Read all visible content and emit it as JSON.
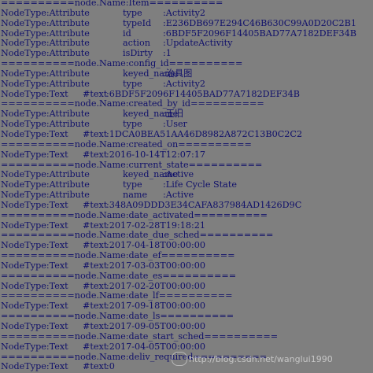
{
  "lines": [
    {
      "kind": "sep",
      "text": "==========node.Name:Item=========="
    },
    {
      "kind": "attr",
      "node": "NodeType:Attribute",
      "key": "type",
      "val": ":Activity2"
    },
    {
      "kind": "attr",
      "node": "NodeType:Attribute",
      "key": "typeId",
      "val": ":E236DB697E294C46B630C99A0D20C2B1"
    },
    {
      "kind": "attr",
      "node": "NodeType:Attribute",
      "key": "id",
      "val": ":6BDF5F2096F14405BAD77A7182DEF34B"
    },
    {
      "kind": "attr",
      "node": "NodeType:Attribute",
      "key": "action",
      "val": ":UpdateActivity"
    },
    {
      "kind": "attr",
      "node": "NodeType:Attribute",
      "key": "isDirty",
      "val": ":1"
    },
    {
      "kind": "sep",
      "text": "==========node.Name:config_id=========="
    },
    {
      "kind": "attr",
      "node": "NodeType:Attribute",
      "key": "keyed_name",
      "val": ":治具图"
    },
    {
      "kind": "attr",
      "node": "NodeType:Attribute",
      "key": "type",
      "val": ":Activity2"
    },
    {
      "kind": "text",
      "node": "NodeType:Text",
      "key": "#text",
      "val": ":6BDF5F2096F14405BAD77A7182DEF34B"
    },
    {
      "kind": "sep",
      "text": "==========node.Name:created_by_id=========="
    },
    {
      "kind": "attr",
      "node": "NodeType:Attribute",
      "key": "keyed_name",
      "val": ":王旧"
    },
    {
      "kind": "attr",
      "node": "NodeType:Attribute",
      "key": "type",
      "val": ":User"
    },
    {
      "kind": "text",
      "node": "NodeType:Text",
      "key": "#text",
      "val": ":1DCA0BEA51AA46D8982A872C13B0C2C2"
    },
    {
      "kind": "sep",
      "text": "==========node.Name:created_on=========="
    },
    {
      "kind": "text",
      "node": "NodeType:Text",
      "key": "#text",
      "val": ":2016-10-14T12:07:17"
    },
    {
      "kind": "sep",
      "text": "==========node.Name:current_state=========="
    },
    {
      "kind": "attr",
      "node": "NodeType:Attribute",
      "key": "keyed_name",
      "val": ":Active"
    },
    {
      "kind": "attr",
      "node": "NodeType:Attribute",
      "key": "type",
      "val": ":Life Cycle State"
    },
    {
      "kind": "attr",
      "node": "NodeType:Attribute",
      "key": "name",
      "val": ":Active"
    },
    {
      "kind": "text",
      "node": "NodeType:Text",
      "key": "#text",
      "val": ":348A09DDD3E34CAFA837984AD1426D9C"
    },
    {
      "kind": "sep",
      "text": "==========node.Name:date_activated=========="
    },
    {
      "kind": "text",
      "node": "NodeType:Text",
      "key": "#text",
      "val": ":2017-02-28T19:18:21"
    },
    {
      "kind": "sep",
      "text": "==========node.Name:date_due_sched=========="
    },
    {
      "kind": "text",
      "node": "NodeType:Text",
      "key": "#text",
      "val": ":2017-04-18T00:00:00"
    },
    {
      "kind": "sep",
      "text": "==========node.Name:date_ef=========="
    },
    {
      "kind": "text",
      "node": "NodeType:Text",
      "key": "#text",
      "val": ":2017-03-03T00:00:00"
    },
    {
      "kind": "sep",
      "text": "==========node.Name:date_es=========="
    },
    {
      "kind": "text",
      "node": "NodeType:Text",
      "key": "#text",
      "val": ":2017-02-20T00:00:00"
    },
    {
      "kind": "sep",
      "text": "==========node.Name:date_lf=========="
    },
    {
      "kind": "text",
      "node": "NodeType:Text",
      "key": "#text",
      "val": ":2017-09-18T00:00:00"
    },
    {
      "kind": "sep",
      "text": "==========node.Name:date_ls=========="
    },
    {
      "kind": "text",
      "node": "NodeType:Text",
      "key": "#text",
      "val": ":2017-09-05T00:00:00"
    },
    {
      "kind": "sep",
      "text": "==========node.Name:date_start_sched=========="
    },
    {
      "kind": "text",
      "node": "NodeType:Text",
      "key": "#text",
      "val": ":2017-04-05T00:00:00"
    },
    {
      "kind": "sep",
      "text": "==========node.Name:deliv_required=========="
    },
    {
      "kind": "text",
      "node": "NodeType:Text",
      "key": "#text",
      "val": ":0"
    }
  ],
  "watermark": "http://blog.csdn.net/wanglui1990",
  "colors": {
    "background": "#7f7f7f",
    "text": "#10106a"
  }
}
